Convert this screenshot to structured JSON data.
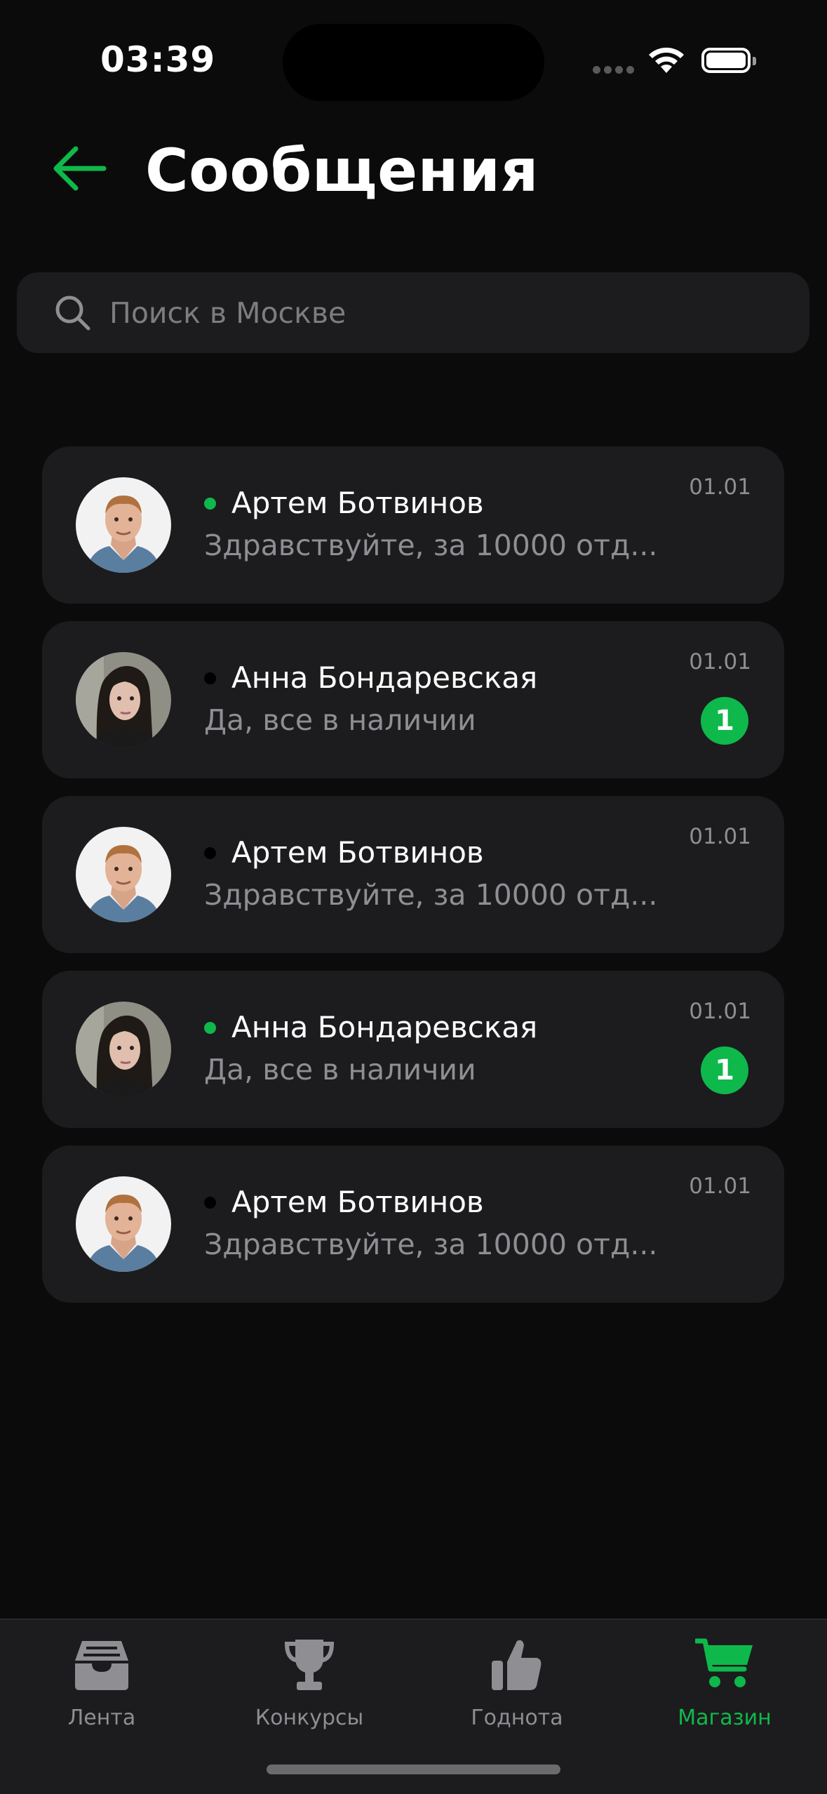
{
  "status_bar": {
    "time": "03:39"
  },
  "header": {
    "title": "Сообщения"
  },
  "search": {
    "placeholder": "Поиск в Москве",
    "value": ""
  },
  "chats": [
    {
      "name": "Артем Ботвинов",
      "preview": "Здравствуйте, за 10000 отд...",
      "date": "01.01",
      "online": true,
      "unread": null,
      "avatar": "man"
    },
    {
      "name": "Анна Бондаревская",
      "preview": "Да, все в наличии",
      "date": "01.01",
      "online": false,
      "unread": "1",
      "avatar": "woman"
    },
    {
      "name": "Артем Ботвинов",
      "preview": "Здравствуйте, за 10000 отд...",
      "date": "01.01",
      "online": false,
      "unread": null,
      "avatar": "man"
    },
    {
      "name": "Анна Бондаревская",
      "preview": "Да, все в наличии",
      "date": "01.01",
      "online": true,
      "unread": "1",
      "avatar": "woman"
    },
    {
      "name": "Артем Ботвинов",
      "preview": "Здравствуйте, за 10000 отд...",
      "date": "01.01",
      "online": false,
      "unread": null,
      "avatar": "man"
    }
  ],
  "tabs": [
    {
      "label": "Лента",
      "icon": "inbox-icon",
      "active": false
    },
    {
      "label": "Конкурсы",
      "icon": "trophy-icon",
      "active": false
    },
    {
      "label": "Годнота",
      "icon": "thumbs-up-icon",
      "active": false
    },
    {
      "label": "Магазин",
      "icon": "cart-icon",
      "active": true
    }
  ],
  "colors": {
    "accent": "#0fb84b",
    "background": "#0b0b0b",
    "card": "#1c1c1e",
    "secondary_text": "#8e8e93",
    "offline_dot": "#000000"
  }
}
